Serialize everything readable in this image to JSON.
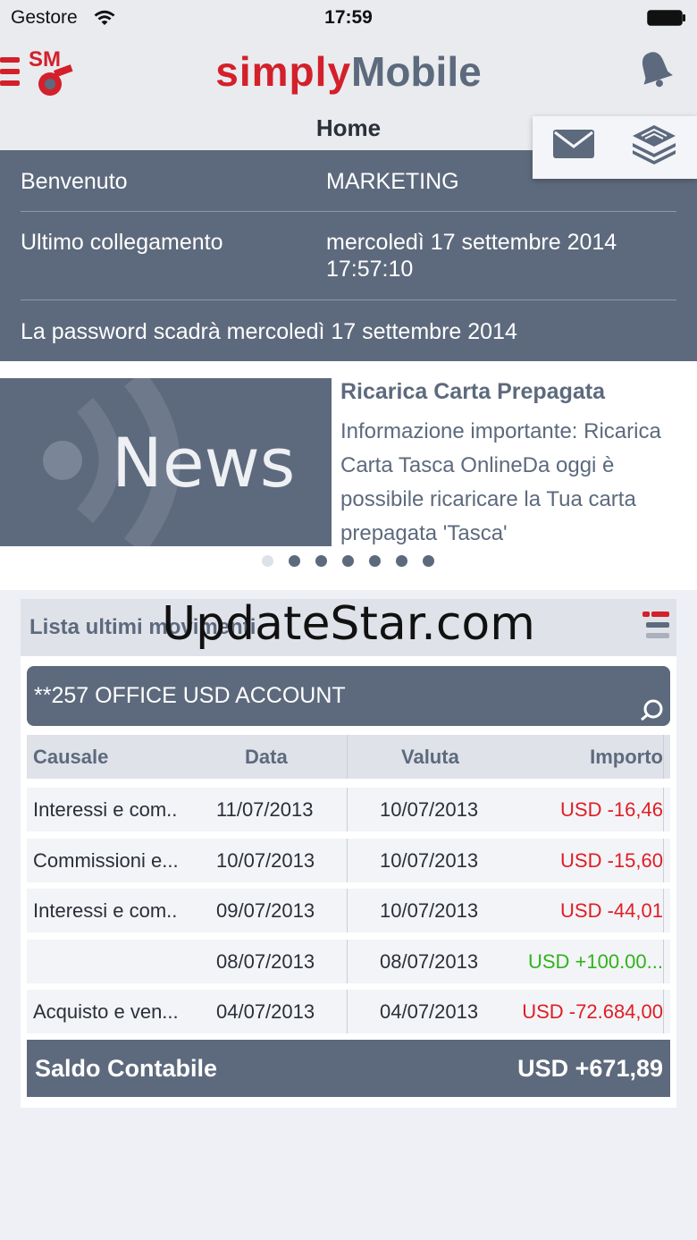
{
  "status": {
    "carrier": "Gestore",
    "time": "17:59"
  },
  "header": {
    "brand_simply": "simply",
    "brand_mobile": "Mobile",
    "page_title": "Home",
    "sm_logo_text": "SM"
  },
  "info": {
    "welcome_label": "Benvenuto",
    "welcome_value": "MARKETING",
    "last_login_label": "Ultimo collegamento",
    "last_login_date": "mercoledì 17 settembre 2014",
    "last_login_time": "17:57:10",
    "password_notice": "La password scadrà mercoledì 17 settembre 2014"
  },
  "news": {
    "banner_text": "News",
    "title": "Ricarica Carta Prepagata",
    "body": "Informazione importante: Ricarica Carta Tasca OnlineDa oggi è possibile ricaricare la Tua carta prepagata 'Tasca'",
    "page_count": 7,
    "active_index": 0
  },
  "movements": {
    "title": "Lista ultimi movimenti",
    "account": "**257 OFFICE USD ACCOUNT",
    "columns": {
      "causale": "Causale",
      "data": "Data",
      "valuta": "Valuta",
      "importo": "Importo"
    },
    "rows": [
      {
        "causale": "Interessi e com..",
        "data": "11/07/2013",
        "valuta": "10/07/2013",
        "importo": "USD -16,46",
        "sign": "neg"
      },
      {
        "causale": "Commissioni e...",
        "data": "10/07/2013",
        "valuta": "10/07/2013",
        "importo": "USD -15,60",
        "sign": "neg"
      },
      {
        "causale": "Interessi e com..",
        "data": "09/07/2013",
        "valuta": "10/07/2013",
        "importo": "USD -44,01",
        "sign": "neg"
      },
      {
        "causale": "",
        "data": "08/07/2013",
        "valuta": "08/07/2013",
        "importo": "USD +100.00...",
        "sign": "pos"
      },
      {
        "causale": "Acquisto e ven...",
        "data": "04/07/2013",
        "valuta": "04/07/2013",
        "importo": "USD -72.684,00",
        "sign": "neg"
      }
    ],
    "balance_label": "Saldo Contabile",
    "balance_value": "USD +671,89"
  },
  "watermark": "UpdateStar.com",
  "colors": {
    "accent_red": "#d3202a",
    "slate": "#5d6a7d",
    "negative": "#e01d24",
    "positive": "#2fb31b"
  }
}
